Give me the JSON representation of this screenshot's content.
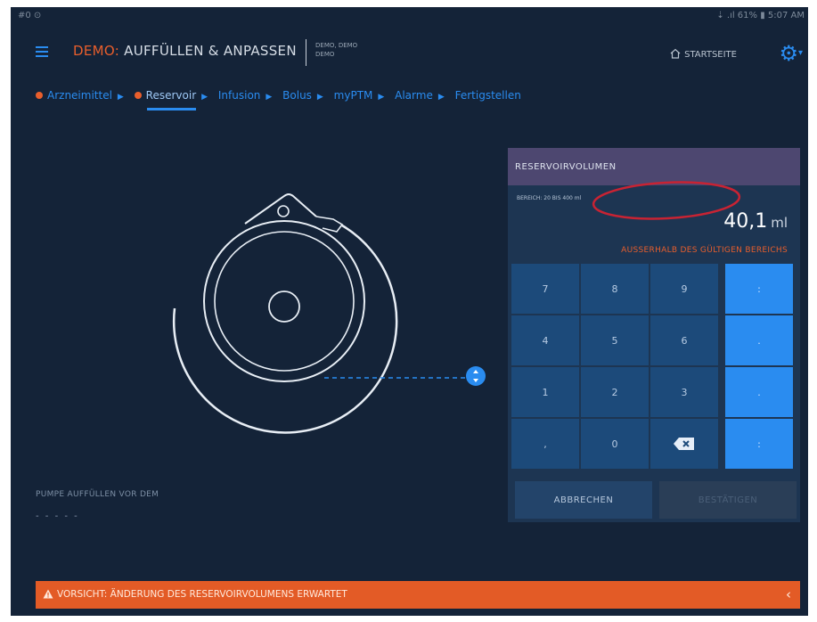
{
  "status_bar": {
    "left": "#0 ⊙",
    "right": "⇣ .ıl 61% ▮ 5:07 AM"
  },
  "header": {
    "title_demo": "DEMO:",
    "title_rest": " AUFFÜLLEN & ANPASSEN",
    "user_line1": "DEMO, DEMO",
    "user_line2": "DEMO",
    "home_label": "STARTSEITE"
  },
  "breadcrumb": [
    {
      "label": "Arzneimittel",
      "warning": true
    },
    {
      "label": "Reservoir",
      "warning": true,
      "active": true
    },
    {
      "label": "Infusion"
    },
    {
      "label": "Bolus"
    },
    {
      "label": "myPTM"
    },
    {
      "label": "Alarme"
    },
    {
      "label": "Fertigstellen"
    }
  ],
  "reservoir": {
    "title": "RESERVOIRVOLUMEN",
    "range": "BEREICH: 20 BIS 400 ml",
    "value": "40,1",
    "unit": "ml",
    "warning": "AUSSERHALB DES GÜLTIGEN BEREICHS",
    "keys": [
      "7",
      "8",
      "9",
      "4",
      "5",
      "6",
      "1",
      "2",
      "3",
      ",",
      "0"
    ],
    "side_keys": [
      ":",
      ".",
      ".",
      ":"
    ],
    "cancel": "ABBRECHEN",
    "confirm": "BESTÄTIGEN"
  },
  "fill_before": {
    "label": "PUMPE AUFFÜLLEN VOR DEM",
    "value": "- - - - -"
  },
  "alert": {
    "text": "VORSICHT: ÄNDERUNG DES RESERVOIRVOLUMENS ERWARTET",
    "chevron": "‹"
  },
  "colors": {
    "background": "#142338",
    "accent": "#2a8cf0",
    "warning": "#e85e2c",
    "panel_header": "#4d4770",
    "annotation": "#c82333"
  }
}
